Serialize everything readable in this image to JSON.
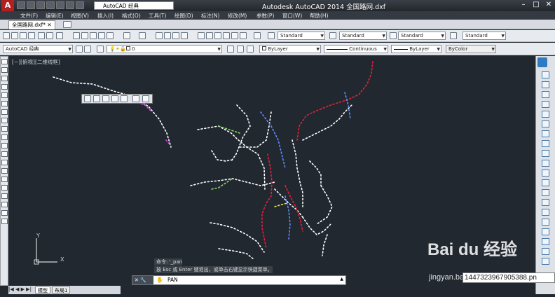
{
  "title_bar": {
    "workspace": "AutoCAD 经典",
    "title": "Autodesk AutoCAD 2014    全国路网.dxf"
  },
  "menu": {
    "items": [
      "文件(F)",
      "编辑(E)",
      "视图(V)",
      "插入(I)",
      "格式(O)",
      "工具(T)",
      "绘图(D)",
      "标注(N)",
      "修改(M)",
      "参数(P)",
      "窗口(W)",
      "帮助(H)"
    ]
  },
  "file_tab": {
    "label": "全国路网.dxf*"
  },
  "toolbar1": {
    "text_style": "Standard",
    "dim_style": "Standard",
    "table_style": "Standard",
    "multileader_style": "Standard"
  },
  "toolbar2": {
    "workspace": "AutoCAD 经典",
    "layer": "0",
    "color": "ByLayer",
    "linetype": "Continuous",
    "lineweight": "ByLayer",
    "plotstyle": "ByColor"
  },
  "viewport": {
    "label": "[−][俯视][二维线框]"
  },
  "ucs": {
    "x": "X",
    "y": "Y"
  },
  "command": {
    "history_1": "命令: '_pan",
    "history_2": "按 Esc 或 Enter 键退出，或单击右键显示快捷菜单。",
    "current": "PAN"
  },
  "layout_tabs": [
    "模型",
    "布局1"
  ],
  "watermark": {
    "brand": "Bai du 经验",
    "url": "jingyan.baidu.com"
  },
  "overlay_id": "1447323967905388.pn",
  "colors": {
    "road_white": "#ffffff",
    "road_red": "#e8203a",
    "road_blue": "#5f8cff",
    "road_green": "#8fd66a",
    "road_magenta": "#d24bd9",
    "road_yellow": "#e8e34a",
    "canvas_bg": "#212830"
  }
}
